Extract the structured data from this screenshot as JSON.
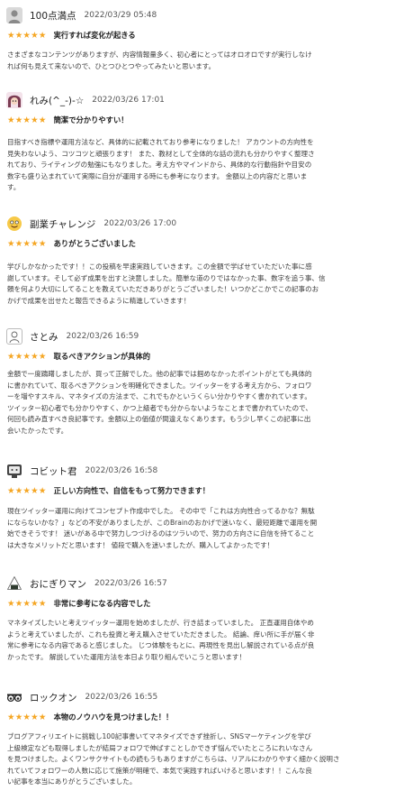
{
  "reviews": [
    {
      "avatar_icon": "default-user-icon",
      "name": "100点満点",
      "date": "2022/03/29 05:48",
      "stars": "★★★★★",
      "title": "実行すれば変化が起きる",
      "body": [
        "さまざまなコンテンツがありますが、内容情報量多く、初心者にとってはオロオロですが実行しなけ",
        "れば何も見えて来ないので、ひとつひとつやってみたいと思います。"
      ]
    },
    {
      "avatar_icon": "anime-character-icon",
      "name": "れみ(^_-)-☆",
      "date": "2022/03/26 17:01",
      "stars": "★★★★★",
      "title": "簡潔で分かりやすい！",
      "body": [
        "目指すべき指標や運用方法など、具体的に記載されており参考になりました！ アカウントの方向性を",
        "見失わないよう、コツコツと頑張ります！ また、教材として全体的な話の流れも分かりやすく整理さ",
        "れており、ライティングの勉強にもなりました。考え方やマインドから、具体的な行動指針や目安の",
        "数字も盛り込まれていて実際に自分が運用する時にも参考になります。 金額以上の内容だと思いま",
        "す。"
      ]
    },
    {
      "avatar_icon": "emoji-face-icon",
      "name": "副業チャレンジ",
      "date": "2022/03/26 17:00",
      "stars": "★★★★★",
      "title": "ありがとうございました",
      "body": [
        "学びしかなかったです！！この投稿を早速実践していきます。この金額で学ばせていただいた事に感",
        "謝しています。そして必ず成果を出すと決意しました。簡単な道のりではなかった事、数字を追う事、信",
        "頼を何より大切にしてることを教えていただきありがとうございました！いつかどこかでこの記事のお",
        "かげで成果を出せたと報告できるように精進していきます！"
      ]
    },
    {
      "avatar_icon": "sketch-person-icon",
      "name": "さとみ",
      "date": "2022/03/26 16:59",
      "stars": "★★★★★",
      "title": "取るべきアクションが具体的",
      "body": [
        "金額で一度躊躇しましたが、買って正解でした。他の記事では掴めなかったポイントがとても具体的",
        "に書かれていて、取るべきアクションを明確化できました。ツイッターをする考え方から、フォロワ",
        "ーを増やすスキル、マネタイズの方法まで、これでもかというくらい分かりやすく書かれています。",
        "ツイッター初心者でも分かりやすく、かつ上級者でも分からないようなことまで書かれていたので、",
        "何回も読み直すべき良記事です。金額以上の価値が間違えなくあります。もう少し早くこの記事に出",
        "会いたかったです。"
      ]
    },
    {
      "avatar_icon": "monitor-robot-icon",
      "name": "コビット君",
      "date": "2022/03/26 16:58",
      "stars": "★★★★★",
      "title": "正しい方向性で、自信をもって努力できます！",
      "body": [
        "現在ツイッター運用に向けてコンセプト作成中でした。 その中で「これは方向性合ってるかな？無駄",
        "にならないかな？」などの不安がありましたが、このBrainのおかげで迷いなく、最短距離で運用を開",
        "始できそうです！ 迷いがある中で努力しつづけるのはツラいので、努力の方向さに自信を持てること",
        "は大きなメリットだと思います！ 値段で購入を迷いましたが、購入してよかったです！"
      ]
    },
    {
      "avatar_icon": "rice-ball-icon",
      "name": "おにぎりマン",
      "date": "2022/03/26 16:57",
      "stars": "★★★★★",
      "title": "非常に参考になる内容でした",
      "body": [
        "マネタイズしたいと考えツイッター運用を始めましたが、行き詰まっていました。 正直運用自体やめ",
        "ようと考えていましたが、これも投資と考え購入させていただきました。 結論、痒い所に手が届く非",
        "常に参考になる内容であると感じました。 じつ体験をもとに、再現性を見出し解説されている点が良",
        "かったです。 解説していた運用方法を本日より取り組んでいこうと思います！"
      ]
    },
    {
      "avatar_icon": "glasses-eyes-icon",
      "name": "ロックオン",
      "date": "2022/03/26 16:55",
      "stars": "★★★★★",
      "title": "本物のノウハウを見つけました！！",
      "body": [
        "ブログアフィリエイトに挑戦し100記事書いてマネタイズできず挫折し、SNSマーケティングを学び",
        "上級検定なども取得しましたが結局フォロワで伸ばすことしかできず悩んでいたところにれいなさん",
        "を見つけました。よくワンサクサイトもの読もうもありますがこちらは、リアルにわかりやすく細かく説明さ",
        "れていてフォロワーの人数に応じて施策が明確で、本気で実践すればいけると思います！！こんな良",
        "い記事を本当にありがとうございました。"
      ]
    }
  ]
}
